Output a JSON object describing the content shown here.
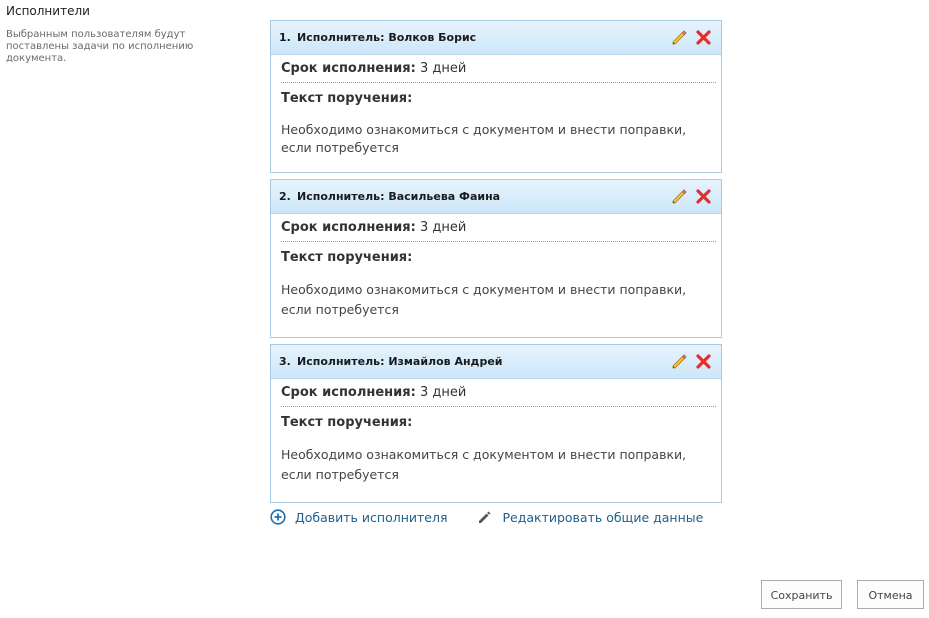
{
  "section": {
    "title": "Исполнители",
    "description": "Выбранным пользователям будут поставлены задачи по исполнению документа."
  },
  "cards": [
    {
      "number": "1.",
      "header": "Исполнитель: Волков Борис",
      "deadline_label": "Срок исполнения:",
      "deadline_value": " 3 дней",
      "text_label": "Текст поручения:",
      "text": "Необходимо ознакомиться с документом и внести поправки, если потребуется"
    },
    {
      "number": "2.",
      "header": "Исполнитель: Васильева Фаина",
      "deadline_label": "Срок исполнения:",
      "deadline_value": " 3 дней",
      "text_label": "Текст поручения:",
      "text": "Необходимо ознакомиться с документом и внести поправки, если потребуется"
    },
    {
      "number": "3.",
      "header": "Исполнитель: Измайлов Андрей",
      "deadline_label": "Срок исполнения:",
      "deadline_value": " 3 дней",
      "text_label": "Текст поручения:",
      "text": "Необходимо ознакомиться с документом и внести поправки, если потребуется"
    }
  ],
  "actions": {
    "add_label": "Добавить исполнителя",
    "edit_common_label": "Редактировать общие данные"
  },
  "buttons": {
    "save": "Сохранить",
    "cancel": "Отмена"
  },
  "icons": {
    "edit": "pencil-icon",
    "delete": "delete-x-icon",
    "add": "plus-circle-icon",
    "edit_common": "pencil-icon"
  },
  "colors": {
    "header_bg": "#d4eafa",
    "card_border": "#a9cbe2",
    "link": "#1f5f8b",
    "delete": "#e03030"
  }
}
